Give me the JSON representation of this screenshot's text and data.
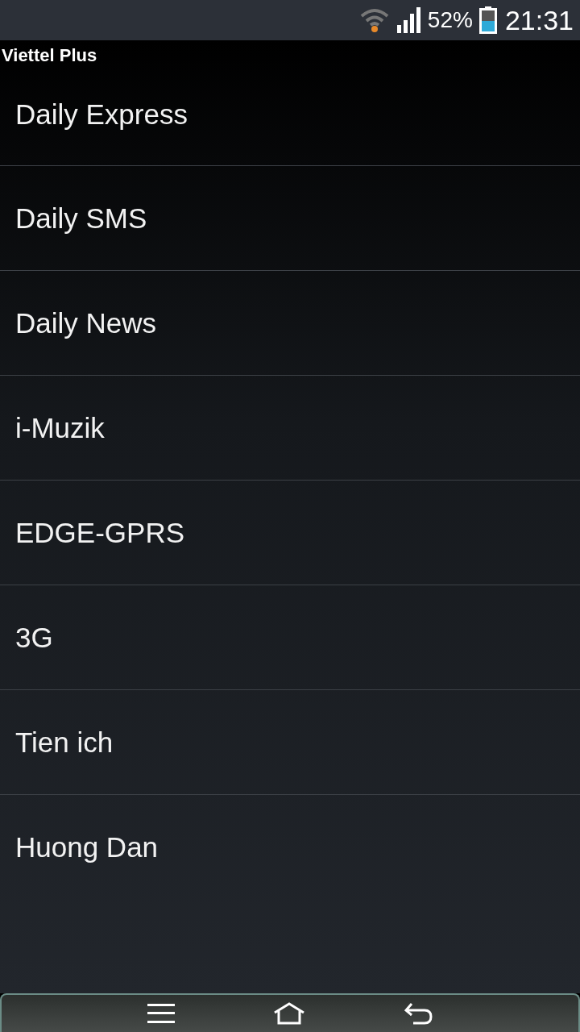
{
  "status_bar": {
    "battery_text": "52%",
    "time": "21:31"
  },
  "window": {
    "title": "Viettel Plus"
  },
  "menu": {
    "items": [
      {
        "label": "Daily Express"
      },
      {
        "label": "Daily SMS"
      },
      {
        "label": "Daily News"
      },
      {
        "label": "i-Muzik"
      },
      {
        "label": "EDGE-GPRS"
      },
      {
        "label": "3G"
      },
      {
        "label": "Tien ich"
      },
      {
        "label": "Huong Dan"
      }
    ]
  }
}
